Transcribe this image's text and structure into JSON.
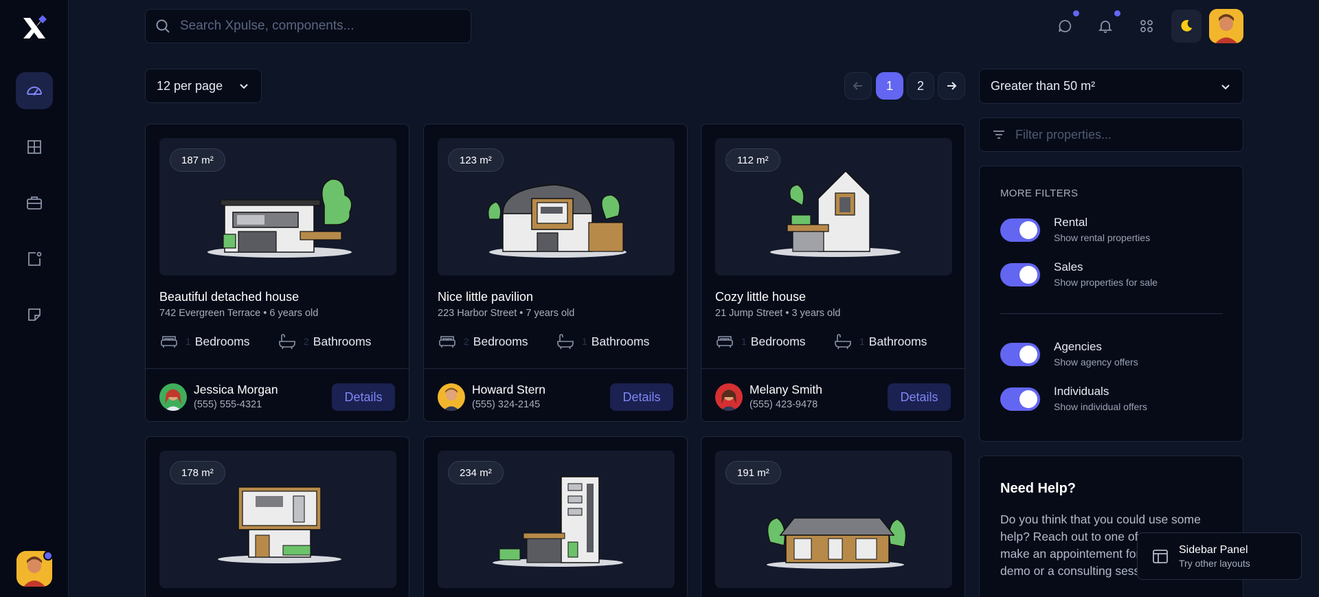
{
  "search": {
    "placeholder": "Search Xpulse, components..."
  },
  "toolbar": {
    "per_page": "12 per page",
    "pages": [
      "1",
      "2"
    ],
    "area_filter": "Greater than 50 m²",
    "filter_placeholder": "Filter properties..."
  },
  "colors": {
    "accent": "#6366f1",
    "background": "#0d1526",
    "surface": "#070b18",
    "sidebar": "#060a16"
  },
  "filters": {
    "title": "MORE FILTERS",
    "group1": [
      {
        "label": "Rental",
        "desc": "Show rental properties",
        "on": true
      },
      {
        "label": "Sales",
        "desc": "Show properties for sale",
        "on": true
      }
    ],
    "group2": [
      {
        "label": "Agencies",
        "desc": "Show agency offers",
        "on": true
      },
      {
        "label": "Individuals",
        "desc": "Show individual offers",
        "on": true
      }
    ]
  },
  "help": {
    "title": "Need Help?",
    "text": "Do you think that you could use some help? Reach out to one of our experts to make an appointement for a personalized demo or a consulting session."
  },
  "toast": {
    "title": "Sidebar Panel",
    "subtitle": "Try other layouts"
  },
  "card_labels": {
    "bedrooms": "Bedrooms",
    "bathrooms": "Bathrooms",
    "details": "Details"
  },
  "cards": [
    {
      "area": "187 m²",
      "title": "Beautiful detached house",
      "sub": "742 Evergreen Terrace • 6 years old",
      "bedrooms": "1",
      "bathrooms": "2",
      "agent": "Jessica Morgan",
      "phone": "(555) 555-4321"
    },
    {
      "area": "123 m²",
      "title": "Nice little pavilion",
      "sub": "223 Harbor Street • 7 years old",
      "bedrooms": "2",
      "bathrooms": "1",
      "agent": "Howard Stern",
      "phone": "(555) 324-2145"
    },
    {
      "area": "112 m²",
      "title": "Cozy little house",
      "sub": "21 Jump Street • 3 years old",
      "bedrooms": "1",
      "bathrooms": "1",
      "agent": "Melany Smith",
      "phone": "(555) 423-9478"
    },
    {
      "area": "178 m²"
    },
    {
      "area": "234 m²"
    },
    {
      "area": "191 m²"
    }
  ]
}
